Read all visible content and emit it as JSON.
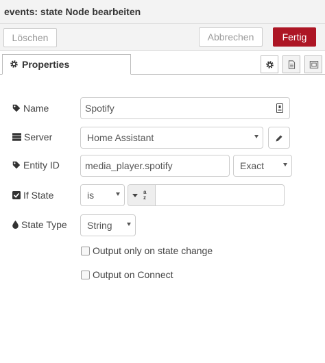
{
  "dialog": {
    "title": "events: state Node bearbeiten"
  },
  "buttons": {
    "delete": "Löschen",
    "cancel": "Abbrechen",
    "done": "Fertig"
  },
  "tabs": {
    "properties": "Properties"
  },
  "tab_icons": [
    "gear-icon",
    "description-icon",
    "appearance-icon"
  ],
  "form": {
    "name": {
      "label": "Name",
      "value": "Spotify"
    },
    "server": {
      "label": "Server",
      "value": "Home Assistant"
    },
    "entity_id": {
      "label": "Entity ID",
      "value": "media_player.spotify",
      "match": "Exact"
    },
    "if_state": {
      "label": "If State",
      "operator": "is",
      "type_icon": "a-z",
      "value": ""
    },
    "state_type": {
      "label": "State Type",
      "value": "String"
    },
    "output_only_on_change": {
      "label": "Output only on state change",
      "checked": false
    },
    "output_on_connect": {
      "label": "Output on Connect",
      "checked": false
    }
  },
  "colors": {
    "primary": "#ad1625"
  }
}
